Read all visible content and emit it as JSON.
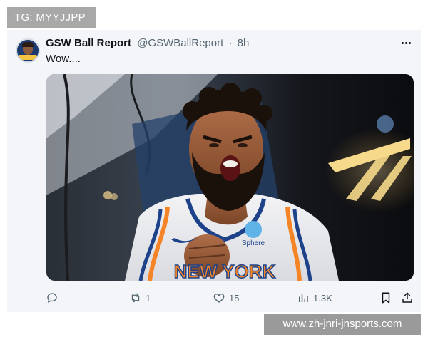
{
  "overlay": {
    "tg_label": "TG: MYYJJPP",
    "watermark_url": "www.zh-jnri-jnsports.com"
  },
  "tweet": {
    "display_name": "GSW Ball Report",
    "handle": "@GSWBallReport",
    "separator": "·",
    "time": "8h",
    "text": "Wow....",
    "media": {
      "jersey_wordmark": "NEW YORK",
      "sponsor": "Sphere"
    },
    "actions": {
      "reply_count": "",
      "retweet_count": "1",
      "like_count": "15",
      "views_count": "1.3K"
    }
  },
  "colors": {
    "text_primary": "#0f1419",
    "text_secondary": "#536471",
    "card_bg": "#f3f5f8",
    "jersey_blue": "#1d428a",
    "jersey_orange": "#f58426"
  },
  "icons": {
    "more": "more-horizontal-icon",
    "reply": "reply-bubble-icon",
    "retweet": "retweet-icon",
    "like": "heart-icon",
    "views": "views-bar-chart-icon",
    "bookmark": "bookmark-icon",
    "share": "share-upload-icon"
  }
}
